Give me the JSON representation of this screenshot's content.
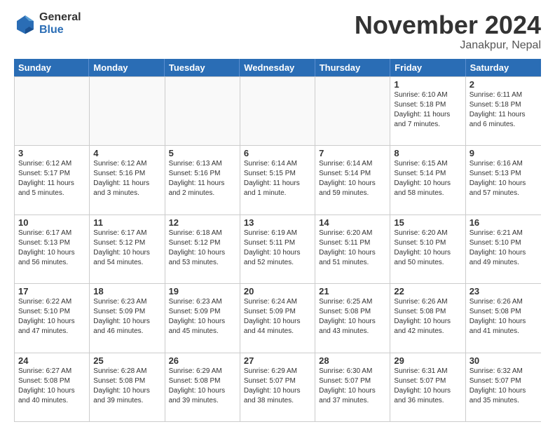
{
  "logo": {
    "general": "General",
    "blue": "Blue"
  },
  "header": {
    "month": "November 2024",
    "location": "Janakpur, Nepal"
  },
  "days": [
    "Sunday",
    "Monday",
    "Tuesday",
    "Wednesday",
    "Thursday",
    "Friday",
    "Saturday"
  ],
  "weeks": [
    [
      {
        "num": "",
        "info": "",
        "empty": true
      },
      {
        "num": "",
        "info": "",
        "empty": true
      },
      {
        "num": "",
        "info": "",
        "empty": true
      },
      {
        "num": "",
        "info": "",
        "empty": true
      },
      {
        "num": "",
        "info": "",
        "empty": true
      },
      {
        "num": "1",
        "info": "Sunrise: 6:10 AM\nSunset: 5:18 PM\nDaylight: 11 hours\nand 7 minutes.",
        "empty": false
      },
      {
        "num": "2",
        "info": "Sunrise: 6:11 AM\nSunset: 5:18 PM\nDaylight: 11 hours\nand 6 minutes.",
        "empty": false
      }
    ],
    [
      {
        "num": "3",
        "info": "Sunrise: 6:12 AM\nSunset: 5:17 PM\nDaylight: 11 hours\nand 5 minutes.",
        "empty": false
      },
      {
        "num": "4",
        "info": "Sunrise: 6:12 AM\nSunset: 5:16 PM\nDaylight: 11 hours\nand 3 minutes.",
        "empty": false
      },
      {
        "num": "5",
        "info": "Sunrise: 6:13 AM\nSunset: 5:16 PM\nDaylight: 11 hours\nand 2 minutes.",
        "empty": false
      },
      {
        "num": "6",
        "info": "Sunrise: 6:14 AM\nSunset: 5:15 PM\nDaylight: 11 hours\nand 1 minute.",
        "empty": false
      },
      {
        "num": "7",
        "info": "Sunrise: 6:14 AM\nSunset: 5:14 PM\nDaylight: 10 hours\nand 59 minutes.",
        "empty": false
      },
      {
        "num": "8",
        "info": "Sunrise: 6:15 AM\nSunset: 5:14 PM\nDaylight: 10 hours\nand 58 minutes.",
        "empty": false
      },
      {
        "num": "9",
        "info": "Sunrise: 6:16 AM\nSunset: 5:13 PM\nDaylight: 10 hours\nand 57 minutes.",
        "empty": false
      }
    ],
    [
      {
        "num": "10",
        "info": "Sunrise: 6:17 AM\nSunset: 5:13 PM\nDaylight: 10 hours\nand 56 minutes.",
        "empty": false
      },
      {
        "num": "11",
        "info": "Sunrise: 6:17 AM\nSunset: 5:12 PM\nDaylight: 10 hours\nand 54 minutes.",
        "empty": false
      },
      {
        "num": "12",
        "info": "Sunrise: 6:18 AM\nSunset: 5:12 PM\nDaylight: 10 hours\nand 53 minutes.",
        "empty": false
      },
      {
        "num": "13",
        "info": "Sunrise: 6:19 AM\nSunset: 5:11 PM\nDaylight: 10 hours\nand 52 minutes.",
        "empty": false
      },
      {
        "num": "14",
        "info": "Sunrise: 6:20 AM\nSunset: 5:11 PM\nDaylight: 10 hours\nand 51 minutes.",
        "empty": false
      },
      {
        "num": "15",
        "info": "Sunrise: 6:20 AM\nSunset: 5:10 PM\nDaylight: 10 hours\nand 50 minutes.",
        "empty": false
      },
      {
        "num": "16",
        "info": "Sunrise: 6:21 AM\nSunset: 5:10 PM\nDaylight: 10 hours\nand 49 minutes.",
        "empty": false
      }
    ],
    [
      {
        "num": "17",
        "info": "Sunrise: 6:22 AM\nSunset: 5:10 PM\nDaylight: 10 hours\nand 47 minutes.",
        "empty": false
      },
      {
        "num": "18",
        "info": "Sunrise: 6:23 AM\nSunset: 5:09 PM\nDaylight: 10 hours\nand 46 minutes.",
        "empty": false
      },
      {
        "num": "19",
        "info": "Sunrise: 6:23 AM\nSunset: 5:09 PM\nDaylight: 10 hours\nand 45 minutes.",
        "empty": false
      },
      {
        "num": "20",
        "info": "Sunrise: 6:24 AM\nSunset: 5:09 PM\nDaylight: 10 hours\nand 44 minutes.",
        "empty": false
      },
      {
        "num": "21",
        "info": "Sunrise: 6:25 AM\nSunset: 5:08 PM\nDaylight: 10 hours\nand 43 minutes.",
        "empty": false
      },
      {
        "num": "22",
        "info": "Sunrise: 6:26 AM\nSunset: 5:08 PM\nDaylight: 10 hours\nand 42 minutes.",
        "empty": false
      },
      {
        "num": "23",
        "info": "Sunrise: 6:26 AM\nSunset: 5:08 PM\nDaylight: 10 hours\nand 41 minutes.",
        "empty": false
      }
    ],
    [
      {
        "num": "24",
        "info": "Sunrise: 6:27 AM\nSunset: 5:08 PM\nDaylight: 10 hours\nand 40 minutes.",
        "empty": false
      },
      {
        "num": "25",
        "info": "Sunrise: 6:28 AM\nSunset: 5:08 PM\nDaylight: 10 hours\nand 39 minutes.",
        "empty": false
      },
      {
        "num": "26",
        "info": "Sunrise: 6:29 AM\nSunset: 5:08 PM\nDaylight: 10 hours\nand 39 minutes.",
        "empty": false
      },
      {
        "num": "27",
        "info": "Sunrise: 6:29 AM\nSunset: 5:07 PM\nDaylight: 10 hours\nand 38 minutes.",
        "empty": false
      },
      {
        "num": "28",
        "info": "Sunrise: 6:30 AM\nSunset: 5:07 PM\nDaylight: 10 hours\nand 37 minutes.",
        "empty": false
      },
      {
        "num": "29",
        "info": "Sunrise: 6:31 AM\nSunset: 5:07 PM\nDaylight: 10 hours\nand 36 minutes.",
        "empty": false
      },
      {
        "num": "30",
        "info": "Sunrise: 6:32 AM\nSunset: 5:07 PM\nDaylight: 10 hours\nand 35 minutes.",
        "empty": false
      }
    ]
  ]
}
